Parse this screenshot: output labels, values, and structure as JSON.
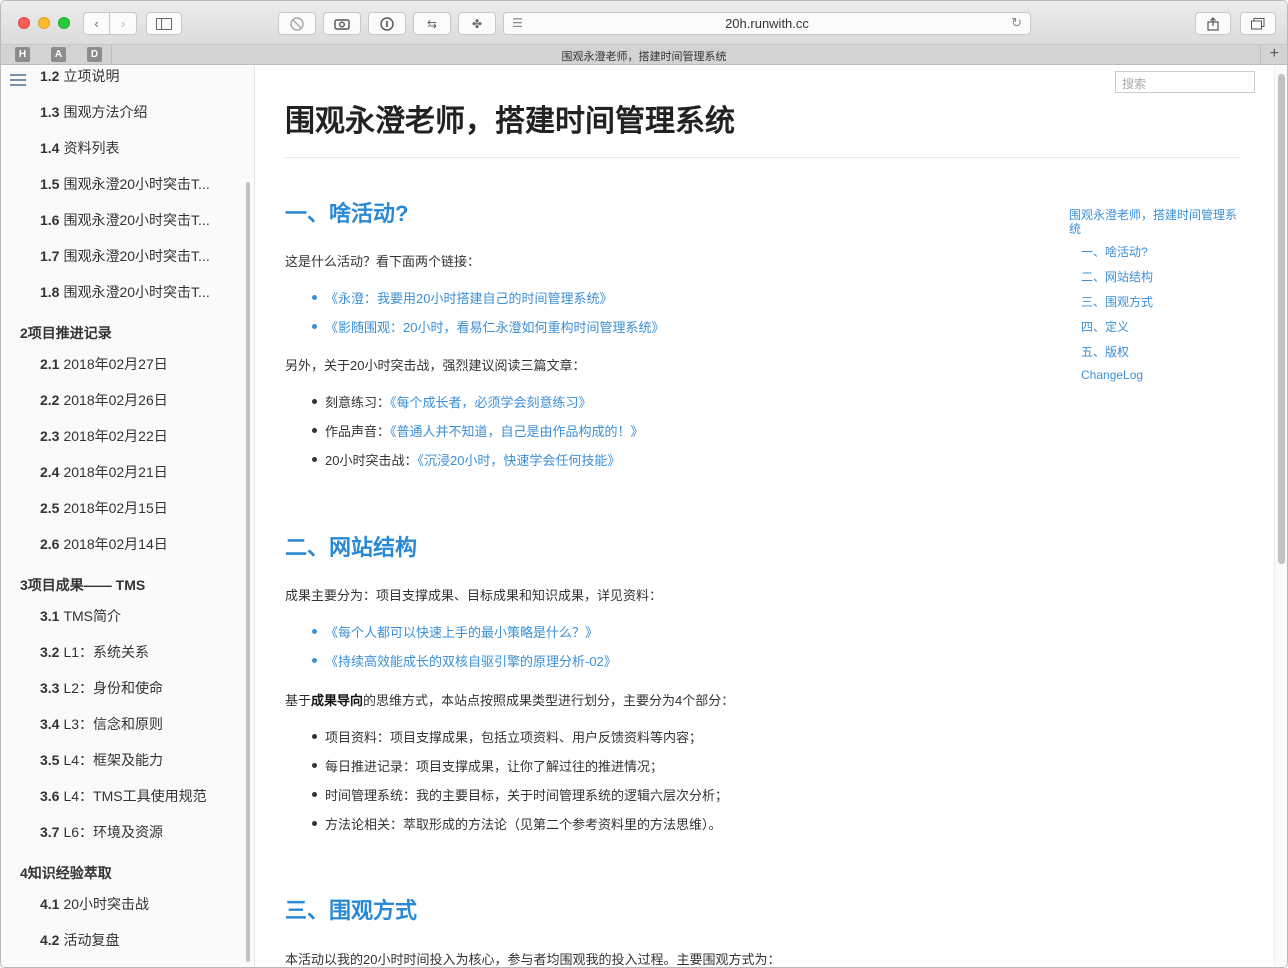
{
  "browser": {
    "url": "20h.runwith.cc",
    "tab_title": "围观永澄老师，搭建时间管理系统",
    "shortcuts": [
      "H",
      "A",
      "D"
    ]
  },
  "sidebar": {
    "items": [
      {
        "num": "1.2",
        "label": "立项说明",
        "type": "item"
      },
      {
        "num": "1.3",
        "label": "围观方法介绍",
        "type": "item"
      },
      {
        "num": "1.4",
        "label": "资料列表",
        "type": "item"
      },
      {
        "num": "1.5",
        "label": "围观永澄20小时突击T...",
        "type": "item"
      },
      {
        "num": "1.6",
        "label": "围观永澄20小时突击T...",
        "type": "item"
      },
      {
        "num": "1.7",
        "label": "围观永澄20小时突击T...",
        "type": "item"
      },
      {
        "num": "1.8",
        "label": "围观永澄20小时突击T...",
        "type": "item"
      },
      {
        "num": "2",
        "label": "项目推进记录",
        "type": "chapter"
      },
      {
        "num": "2.1",
        "label": "2018年02月27日",
        "type": "item"
      },
      {
        "num": "2.2",
        "label": "2018年02月26日",
        "type": "item"
      },
      {
        "num": "2.3",
        "label": "2018年02月22日",
        "type": "item"
      },
      {
        "num": "2.4",
        "label": "2018年02月21日",
        "type": "item"
      },
      {
        "num": "2.5",
        "label": "2018年02月15日",
        "type": "item"
      },
      {
        "num": "2.6",
        "label": "2018年02月14日",
        "type": "item"
      },
      {
        "num": "3",
        "label": "项目成果—— TMS",
        "type": "chapter"
      },
      {
        "num": "3.1",
        "label": "TMS简介",
        "type": "item"
      },
      {
        "num": "3.2",
        "label": "L1：系统关系",
        "type": "item"
      },
      {
        "num": "3.3",
        "label": "L2：身份和使命",
        "type": "item"
      },
      {
        "num": "3.4",
        "label": "L3：信念和原则",
        "type": "item"
      },
      {
        "num": "3.5",
        "label": "L4：框架及能力",
        "type": "item"
      },
      {
        "num": "3.6",
        "label": "L4：TMS工具使用规范",
        "type": "item"
      },
      {
        "num": "3.7",
        "label": "L6：环境及资源",
        "type": "item"
      },
      {
        "num": "4",
        "label": "知识经验萃取",
        "type": "chapter"
      },
      {
        "num": "4.1",
        "label": "20小时突击战",
        "type": "item"
      },
      {
        "num": "4.2",
        "label": "活动复盘",
        "type": "item"
      }
    ]
  },
  "search": {
    "placeholder": "搜索"
  },
  "content": {
    "title": "围观永澄老师，搭建时间管理系统",
    "s1": {
      "heading": "一、啥活动?",
      "intro": "这是什么活动？看下面两个链接：",
      "links": [
        "《永澄：我要用20小时搭建自己的时间管理系统》",
        "《影随围观：20小时，看易仁永澄如何重构时间管理系统》"
      ],
      "also": "另外，关于20小时突击战，强烈建议阅读三篇文章：",
      "articles": [
        {
          "label": "刻意练习：",
          "link": "《每个成长者，必须学会刻意练习》"
        },
        {
          "label": "作品声音：",
          "link": "《普通人并不知道，自己是由作品构成的！》"
        },
        {
          "label": "20小时突击战：",
          "link": "《沉浸20小时，快速学会任何技能》"
        }
      ]
    },
    "s2": {
      "heading": "二、网站结构",
      "intro": "成果主要分为：项目支撑成果、目标成果和知识成果，详见资料：",
      "links": [
        "《每个人都可以快速上手的最小策略是什么？》",
        "《持续高效能成长的双核自驱引擎的原理分析-02》"
      ],
      "basis_pre": "基于",
      "basis_bold": "成果导向",
      "basis_post": "的思维方式，本站点按照成果类型进行划分，主要分为4个部分：",
      "parts": [
        "项目资料：项目支撑成果，包括立项资料、用户反馈资料等内容；",
        "每日推进记录：项目支撑成果，让你了解过往的推进情况；",
        "时间管理系统：我的主要目标，关于时间管理系统的逻辑六层次分析；",
        "方法论相关：萃取形成的方法论（见第二个参考资料里的方法思维）。"
      ]
    },
    "s3": {
      "heading": "三、围观方式",
      "intro": "本活动以我的20小时时间投入为核心，参与者均围观我的投入过程。主要围观方式为："
    }
  },
  "right_toc": {
    "title": "围观永澄老师，搭建时间管理系统",
    "items": [
      "一、啥活动?",
      "二、网站结构",
      "三、围观方式",
      "四、定义",
      "五、版权",
      "ChangeLog"
    ]
  },
  "colors": {
    "link": "#3b8fd6",
    "heading": "#2a89d4"
  }
}
